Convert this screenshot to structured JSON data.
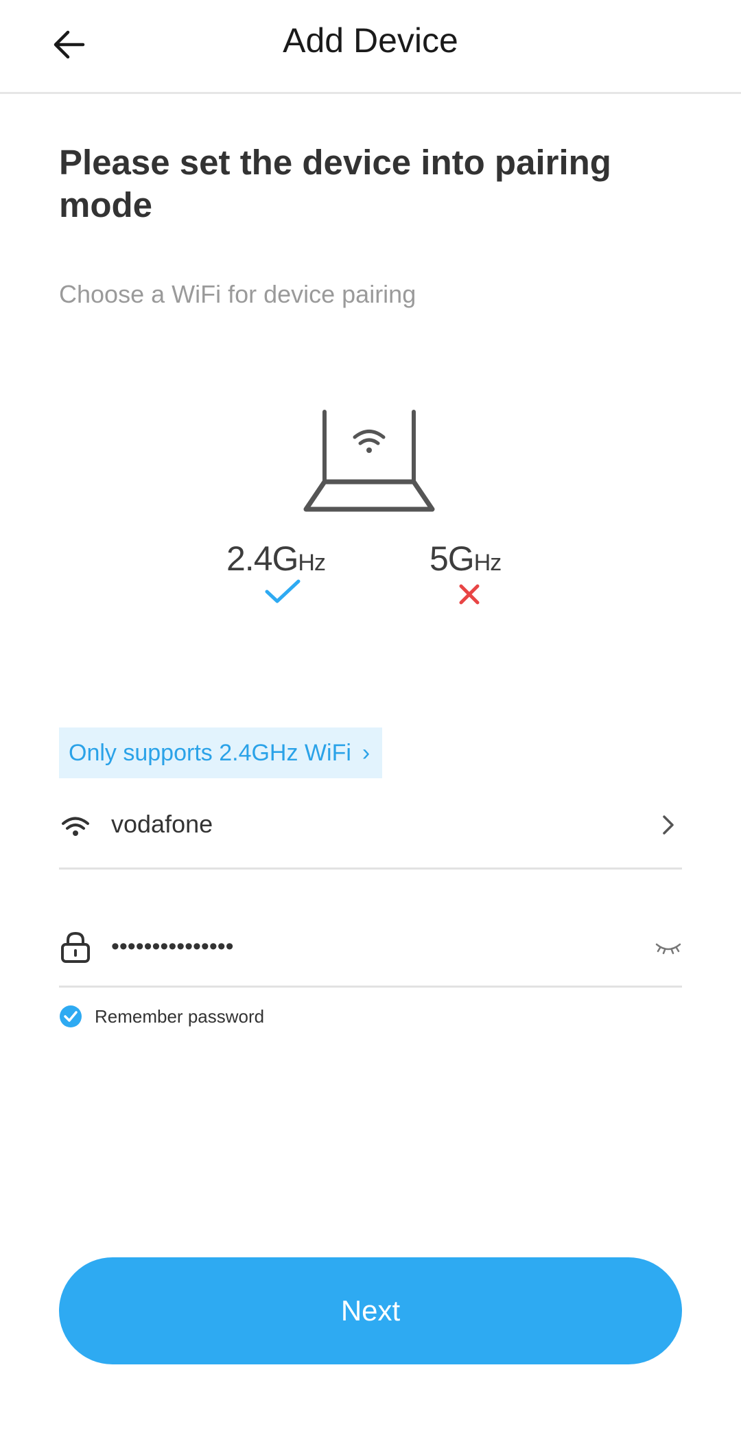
{
  "app_bar": {
    "title": "Add Device",
    "back_icon": "arrow-left-icon"
  },
  "content": {
    "headline": "Please set the device into pairing mode",
    "subtitle": "Choose a WiFi for device pairing"
  },
  "illustration": {
    "band_24": {
      "value": "2.4G",
      "unit": "Hz",
      "supported": true
    },
    "band_5": {
      "value": "5G",
      "unit": "Hz",
      "supported": false
    },
    "colors": {
      "check": "#2eaaf2",
      "cross": "#e84545",
      "router": "#555555"
    }
  },
  "wifi_note": {
    "label": "Only supports 2.4GHz WiFi",
    "chevron": "›"
  },
  "ssid": {
    "value": "vodafone",
    "icon": "wifi-icon",
    "trailing_icon": "chevron-right-icon"
  },
  "password": {
    "value": "•••••••••••••••",
    "icon": "lock-icon",
    "trailing_icon": "eye-closed-icon"
  },
  "remember": {
    "label": "Remember password",
    "checked": true
  },
  "next_button": {
    "label": "Next"
  },
  "colors": {
    "accent": "#2eaaf2",
    "note_bg": "#e2f3fd",
    "note_text": "#2aa2e8"
  }
}
